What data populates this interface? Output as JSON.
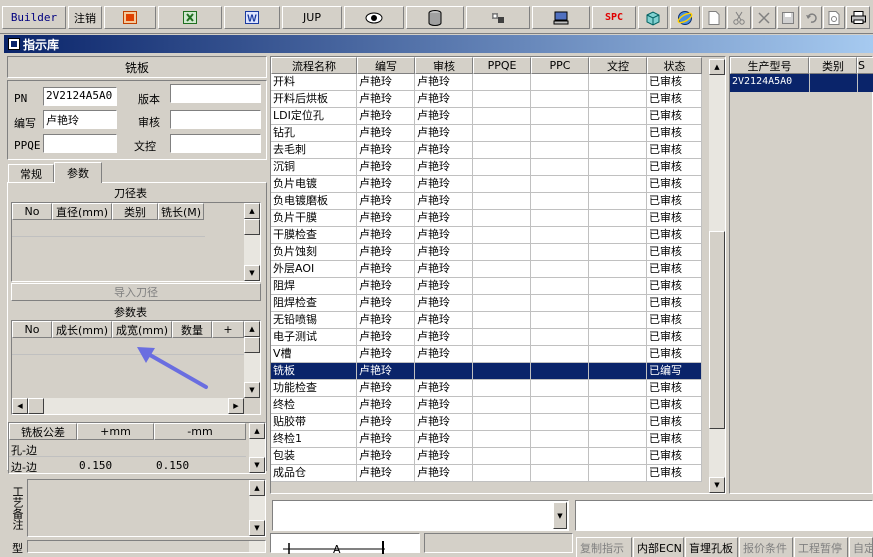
{
  "toolbar": {
    "builder_label": "Builder",
    "logout_label": "注销",
    "jup_label": "JUP",
    "spc_label": "SPC"
  },
  "window": {
    "title": "指示库"
  },
  "left_panel": {
    "group_title": "铣板",
    "pn_label": "PN",
    "pn_value": "2V2124A5A0",
    "version_label": "版本",
    "version_value": "",
    "author_label": "编写",
    "author_value": "卢艳玲",
    "review_label": "审核",
    "review_value": "",
    "ppqe_label": "PPQE",
    "ppqe_value": "",
    "doc_control_label": "文控",
    "doc_control_value": "",
    "tabs": [
      "常规",
      "参数"
    ],
    "active_tab": "参数",
    "tool_table_title": "刀径表",
    "tool_table_headers": [
      "No",
      "直径(mm)",
      "类别",
      "铣长(M)"
    ],
    "import_tool_label": "导入刀径",
    "param_table_title": "参数表",
    "param_table_headers": [
      "No",
      "成长(mm)",
      "成宽(mm)",
      "数量",
      "+"
    ],
    "tolerance_headers": [
      "铣板公差",
      "+mm",
      "-mm"
    ],
    "tolerance_rows": [
      {
        "name": "孔-边",
        "plus": "",
        "minus": ""
      },
      {
        "name": "边-边",
        "plus": "0.150",
        "minus": "0.150"
      }
    ],
    "process_note_label": "工艺备注",
    "type_label": "型"
  },
  "process_grid": {
    "headers": [
      "流程名称",
      "编写",
      "审核",
      "PPQE",
      "PPC",
      "文控",
      "状态"
    ],
    "selected_index": 15,
    "rows": [
      [
        "开料",
        "卢艳玲",
        "卢艳玲",
        "",
        "",
        "",
        "已审核"
      ],
      [
        "开料后烘板",
        "卢艳玲",
        "卢艳玲",
        "",
        "",
        "",
        "已审核"
      ],
      [
        "LDI定位孔",
        "卢艳玲",
        "卢艳玲",
        "",
        "",
        "",
        "已审核"
      ],
      [
        "钻孔",
        "卢艳玲",
        "卢艳玲",
        "",
        "",
        "",
        "已审核"
      ],
      [
        "去毛刺",
        "卢艳玲",
        "卢艳玲",
        "",
        "",
        "",
        "已审核"
      ],
      [
        "沉铜",
        "卢艳玲",
        "卢艳玲",
        "",
        "",
        "",
        "已审核"
      ],
      [
        "负片电镀",
        "卢艳玲",
        "卢艳玲",
        "",
        "",
        "",
        "已审核"
      ],
      [
        "负电镀磨板",
        "卢艳玲",
        "卢艳玲",
        "",
        "",
        "",
        "已审核"
      ],
      [
        "负片干膜",
        "卢艳玲",
        "卢艳玲",
        "",
        "",
        "",
        "已审核"
      ],
      [
        "干膜检查",
        "卢艳玲",
        "卢艳玲",
        "",
        "",
        "",
        "已审核"
      ],
      [
        "负片蚀刻",
        "卢艳玲",
        "卢艳玲",
        "",
        "",
        "",
        "已审核"
      ],
      [
        "外层AOI",
        "卢艳玲",
        "卢艳玲",
        "",
        "",
        "",
        "已审核"
      ],
      [
        "阻焊",
        "卢艳玲",
        "卢艳玲",
        "",
        "",
        "",
        "已审核"
      ],
      [
        "阻焊检查",
        "卢艳玲",
        "卢艳玲",
        "",
        "",
        "",
        "已审核"
      ],
      [
        "无铅喷锡",
        "卢艳玲",
        "卢艳玲",
        "",
        "",
        "",
        "已审核"
      ],
      [
        "电子测试",
        "卢艳玲",
        "卢艳玲",
        "",
        "",
        "",
        "已审核"
      ],
      [
        "V槽",
        "卢艳玲",
        "卢艳玲",
        "",
        "",
        "",
        "已审核"
      ],
      [
        "铣板",
        "卢艳玲",
        "",
        "",
        "",
        "",
        "已编写"
      ],
      [
        "功能检查",
        "卢艳玲",
        "卢艳玲",
        "",
        "",
        "",
        "已审核"
      ],
      [
        "终检",
        "卢艳玲",
        "卢艳玲",
        "",
        "",
        "",
        "已审核"
      ],
      [
        "贴胶带",
        "卢艳玲",
        "卢艳玲",
        "",
        "",
        "",
        "已审核"
      ],
      [
        "终检1",
        "卢艳玲",
        "卢艳玲",
        "",
        "",
        "",
        "已审核"
      ],
      [
        "包装",
        "卢艳玲",
        "卢艳玲",
        "",
        "",
        "",
        "已审核"
      ],
      [
        "成品仓",
        "卢艳玲",
        "卢艳玲",
        "",
        "",
        "",
        "已审核"
      ]
    ]
  },
  "model_grid": {
    "headers": [
      "生产型号",
      "类别",
      "S"
    ],
    "rows": [
      [
        "2V2124A5A0",
        "",
        ""
      ]
    ]
  },
  "bottom_tabs": [
    "复制指示",
    "内部ECN",
    "盲埋孔板",
    "报价条件",
    "工程暂停",
    "自定"
  ],
  "bottom_diagram_label": "A",
  "colors": {
    "selection": "#0a246a",
    "titlebar": "#0a246a",
    "window_bg": "#d4d0c8",
    "arrow": "#6a6ee0"
  }
}
